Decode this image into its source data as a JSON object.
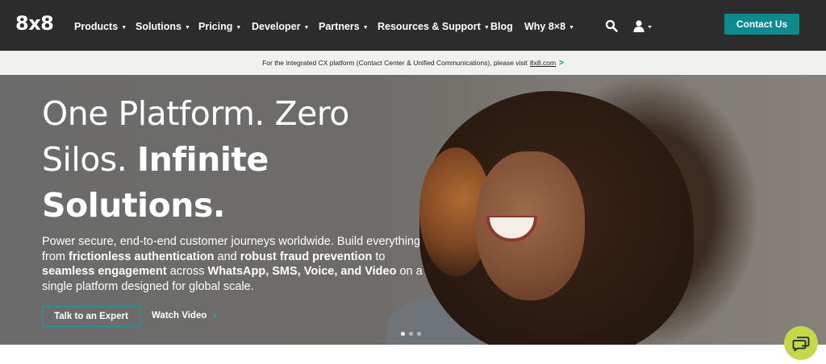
{
  "nav": {
    "logo": "8x8",
    "items": [
      {
        "label": "Products",
        "caret": "▼"
      },
      {
        "label": "Solutions",
        "caret": "▼"
      },
      {
        "label": "Pricing",
        "caret": "▼"
      },
      {
        "label": "Developer",
        "caret": "▼"
      },
      {
        "label": "Partners",
        "caret": "▼"
      },
      {
        "label": "Resources & Support",
        "caret": "▼"
      },
      {
        "label": "Blog",
        "caret": ""
      },
      {
        "label": "Why 8×8",
        "caret": "▼"
      }
    ],
    "search_icon": "search-icon",
    "account_icon": "user-icon",
    "contact_label": "Contact Us"
  },
  "announcement": {
    "text": "For the integrated CX platform (Contact Center & Unified Communications), please visit",
    "link": "8x8.com",
    "arrow": ">"
  },
  "hero": {
    "title_line1": "One Platform. Zero",
    "title_line2_normal": "Silos.",
    "title_line2_bold": "Infinite",
    "title_line3_bold": "Solutions.",
    "desc": {
      "p1": "Power secure, end-to-end customer journeys worldwide. Build everything from ",
      "b1": "frictionless authentication",
      "p2": " and ",
      "b2": "robust fraud prevention",
      "p3": " to ",
      "b3": "seamless engagement",
      "p4": " across ",
      "b4": "WhatsApp, SMS, Voice, and Video",
      "p5": " on a single platform designed for global scale."
    },
    "primary_cta": "Talk to an Expert",
    "secondary_cta": "Watch Video",
    "secondary_arrow": "›",
    "carousel_active": 1,
    "carousel_count": 3
  },
  "chat": {
    "icon": "chat-icon"
  },
  "colors": {
    "nav_bg": "#2c2c2c",
    "accent": "#0d8a8e",
    "chat_bg": "#c4d84a",
    "announce_bg": "#f1f1ed"
  }
}
